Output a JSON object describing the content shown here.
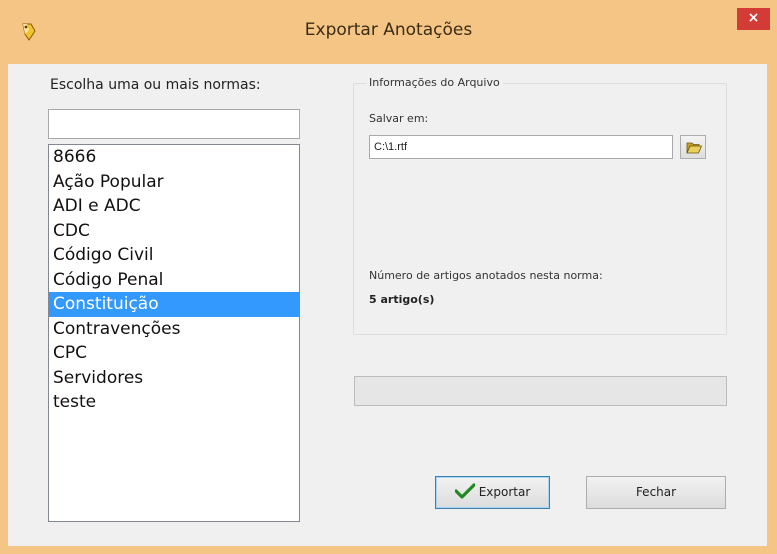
{
  "window": {
    "title": "Exportar Anotações",
    "close_glyph": "×",
    "accent_color": "#f4c585",
    "close_color": "#d23b36",
    "icon": "app-pencil-icon"
  },
  "left": {
    "choose_label": "Escolha uma ou mais normas:",
    "filter_value": "",
    "items": [
      {
        "label": "8666",
        "selected": false
      },
      {
        "label": "Ação Popular",
        "selected": false
      },
      {
        "label": "ADI e ADC",
        "selected": false
      },
      {
        "label": "CDC",
        "selected": false
      },
      {
        "label": "Código Civil",
        "selected": false
      },
      {
        "label": "Código Penal",
        "selected": false
      },
      {
        "label": "Constituição",
        "selected": true
      },
      {
        "label": "Contravenções",
        "selected": false
      },
      {
        "label": "CPC",
        "selected": false
      },
      {
        "label": "Servidores",
        "selected": false
      },
      {
        "label": "teste",
        "selected": false
      }
    ],
    "selection_color": "#3399ff"
  },
  "file_info": {
    "group_title": "Informações do Arquivo",
    "save_label": "Salvar em:",
    "path_value": "C:\\1.rtf",
    "browse_icon": "folder-open-icon",
    "count_label": "Número de artigos anotados nesta norma:",
    "count_value": "5 artigo(s)"
  },
  "progress": {
    "value": 0
  },
  "buttons": {
    "export_label": "Exportar",
    "export_icon": "checkmark-icon",
    "close_label": "Fechar"
  }
}
